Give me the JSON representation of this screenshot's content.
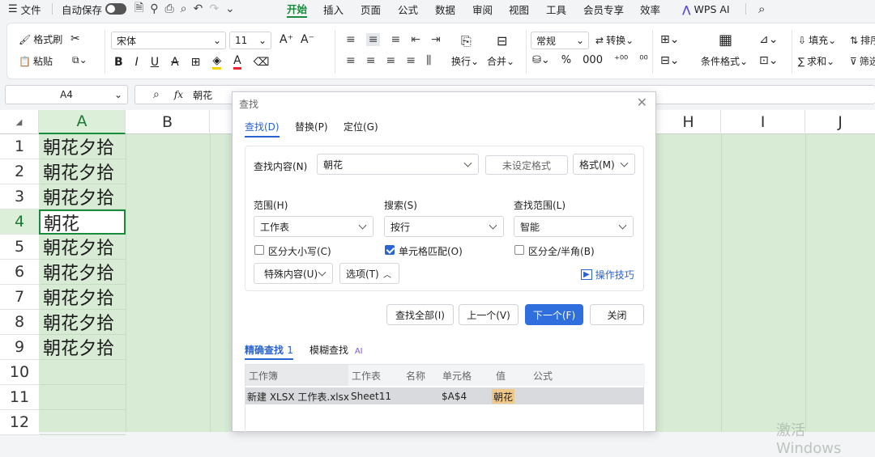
{
  "menubar": {
    "file": "文件",
    "autosave": "自动保存",
    "tabs": [
      "开始",
      "插入",
      "页面",
      "公式",
      "数据",
      "审阅",
      "视图",
      "工具",
      "会员专享",
      "效率"
    ],
    "wpsai": "WPS AI"
  },
  "ribbon": {
    "format_painter": "格式刷",
    "paste": "粘贴",
    "font": "宋体",
    "size": "11",
    "number_format": "常规",
    "convert": "转换",
    "wrap": "换行",
    "merge": "合并",
    "cond_format": "条件格式",
    "fill": "填充",
    "sum": "求和",
    "sort": "排序",
    "filter": "筛选",
    "pct": "%",
    "thousands": "000",
    "dec_up": "⁺⁰⁰",
    "dec_down": "⁰⁰"
  },
  "formula_bar": {
    "cell_ref": "A4",
    "fx": "fx",
    "value": "朝花"
  },
  "sheet": {
    "columns": [
      "A",
      "B",
      "H",
      "I",
      "J"
    ],
    "rows": [
      "1",
      "2",
      "3",
      "4",
      "5",
      "6",
      "7",
      "8",
      "9",
      "10",
      "11",
      "12"
    ],
    "cells": [
      "朝花夕拾",
      "朝花夕拾",
      "朝花夕拾",
      "朝花",
      "朝花夕拾",
      "朝花夕拾",
      "朝花夕拾",
      "朝花夕拾",
      "朝花夕拾"
    ]
  },
  "dialog": {
    "title": "查找",
    "tabs": [
      "查找(D)",
      "替换(P)",
      "定位(G)"
    ],
    "find_label": "查找内容(N)",
    "find_value": "朝花",
    "no_format": "未设定格式",
    "format_btn": "格式(M)",
    "scope_label": "范围(H)",
    "scope_value": "工作表",
    "search_label": "搜索(S)",
    "search_value": "按行",
    "lookin_label": "查找范围(L)",
    "lookin_value": "智能",
    "match_case": "区分大小写(C)",
    "match_cell": "单元格匹配(O)",
    "match_width": "区分全/半角(B)",
    "special": "特殊内容(U)",
    "options": "选项(T)",
    "tips": "操作技巧",
    "find_all": "查找全部(I)",
    "prev": "上一个(V)",
    "next": "下一个(F)",
    "close": "关闭",
    "exact": "精确查找",
    "exact_count": "1",
    "fuzzy": "模糊查找",
    "ai": "AI",
    "headers": [
      "工作簿",
      "工作表",
      "名称",
      "单元格",
      "值",
      "公式"
    ],
    "result": {
      "book": "新建 XLSX 工作表.xlsx",
      "sheet": "Sheet11",
      "name": "",
      "cell": "$A$4",
      "value": "朝花",
      "formula": ""
    }
  },
  "watermark": "激活 Windows"
}
